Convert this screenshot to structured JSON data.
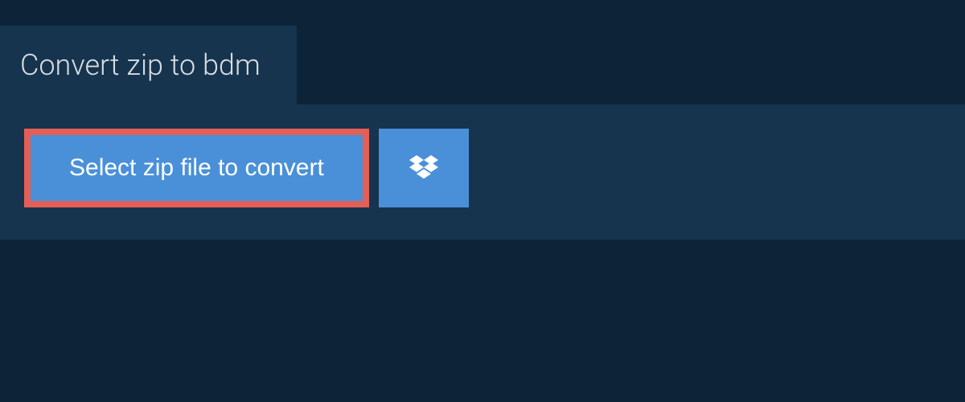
{
  "tab": {
    "title": "Convert zip to bdm"
  },
  "actions": {
    "select_label": "Select zip file to convert"
  },
  "colors": {
    "page_bg": "#0d2438",
    "panel_bg": "#16344e",
    "button_bg": "#4a90d9",
    "button_border": "#e45f56",
    "text_light": "#ffffff"
  }
}
